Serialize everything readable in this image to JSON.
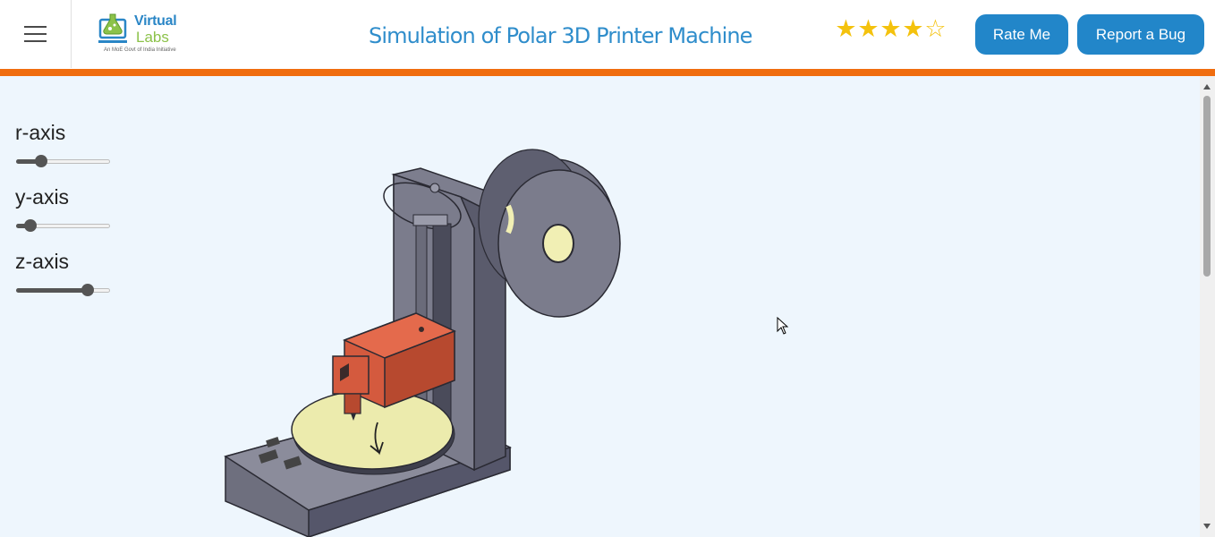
{
  "header": {
    "menu_icon": "hamburger-menu-icon",
    "logo": {
      "brand_line1": "Virtual",
      "brand_line2": "Labs",
      "tagline": "An MoE Govt of India Initiative"
    },
    "title": "Simulation of Polar 3D Printer Machine",
    "rating": {
      "value": 4,
      "max": 5,
      "icon": "star-icon",
      "color": "#f4c20d"
    },
    "rate_button": "Rate Me",
    "bug_button": "Report a Bug",
    "accent_color": "#f06d0f"
  },
  "controls": [
    {
      "label": "r-axis",
      "value_fraction": 0.23
    },
    {
      "label": "y-axis",
      "value_fraction": 0.1
    },
    {
      "label": "z-axis",
      "value_fraction": 0.8
    }
  ],
  "scene": {
    "image": "polar-3d-printer-illustration",
    "bed_icon": "rotation-arrow-icon"
  }
}
